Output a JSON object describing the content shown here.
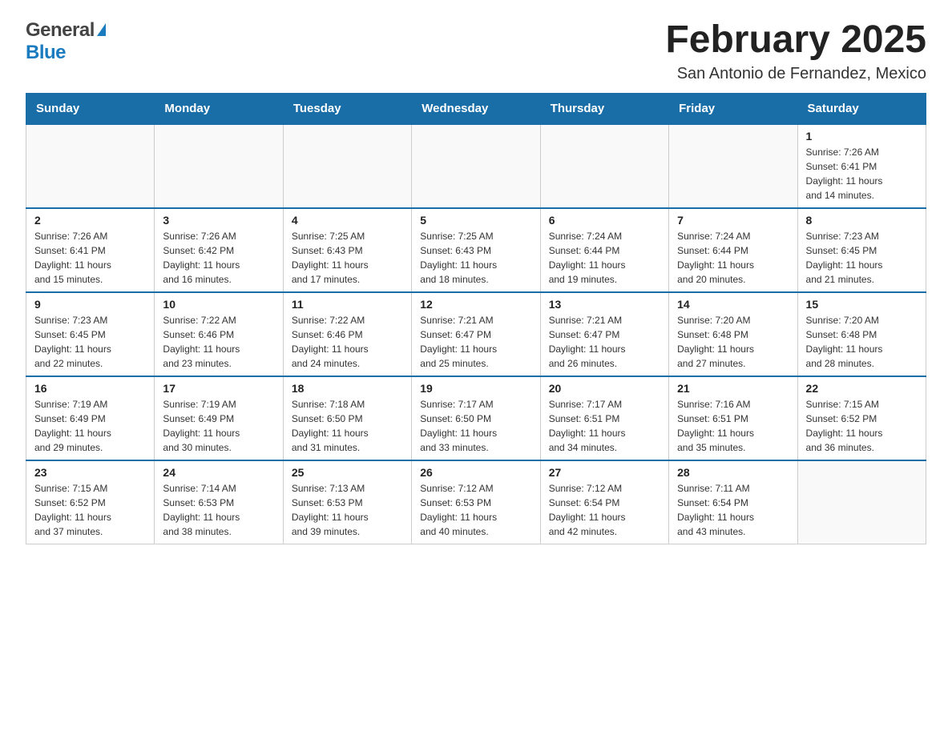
{
  "header": {
    "logo_general": "General",
    "logo_blue": "Blue",
    "title": "February 2025",
    "subtitle": "San Antonio de Fernandez, Mexico"
  },
  "days_of_week": [
    "Sunday",
    "Monday",
    "Tuesday",
    "Wednesday",
    "Thursday",
    "Friday",
    "Saturday"
  ],
  "weeks": [
    [
      {
        "day": "",
        "info": ""
      },
      {
        "day": "",
        "info": ""
      },
      {
        "day": "",
        "info": ""
      },
      {
        "day": "",
        "info": ""
      },
      {
        "day": "",
        "info": ""
      },
      {
        "day": "",
        "info": ""
      },
      {
        "day": "1",
        "info": "Sunrise: 7:26 AM\nSunset: 6:41 PM\nDaylight: 11 hours\nand 14 minutes."
      }
    ],
    [
      {
        "day": "2",
        "info": "Sunrise: 7:26 AM\nSunset: 6:41 PM\nDaylight: 11 hours\nand 15 minutes."
      },
      {
        "day": "3",
        "info": "Sunrise: 7:26 AM\nSunset: 6:42 PM\nDaylight: 11 hours\nand 16 minutes."
      },
      {
        "day": "4",
        "info": "Sunrise: 7:25 AM\nSunset: 6:43 PM\nDaylight: 11 hours\nand 17 minutes."
      },
      {
        "day": "5",
        "info": "Sunrise: 7:25 AM\nSunset: 6:43 PM\nDaylight: 11 hours\nand 18 minutes."
      },
      {
        "day": "6",
        "info": "Sunrise: 7:24 AM\nSunset: 6:44 PM\nDaylight: 11 hours\nand 19 minutes."
      },
      {
        "day": "7",
        "info": "Sunrise: 7:24 AM\nSunset: 6:44 PM\nDaylight: 11 hours\nand 20 minutes."
      },
      {
        "day": "8",
        "info": "Sunrise: 7:23 AM\nSunset: 6:45 PM\nDaylight: 11 hours\nand 21 minutes."
      }
    ],
    [
      {
        "day": "9",
        "info": "Sunrise: 7:23 AM\nSunset: 6:45 PM\nDaylight: 11 hours\nand 22 minutes."
      },
      {
        "day": "10",
        "info": "Sunrise: 7:22 AM\nSunset: 6:46 PM\nDaylight: 11 hours\nand 23 minutes."
      },
      {
        "day": "11",
        "info": "Sunrise: 7:22 AM\nSunset: 6:46 PM\nDaylight: 11 hours\nand 24 minutes."
      },
      {
        "day": "12",
        "info": "Sunrise: 7:21 AM\nSunset: 6:47 PM\nDaylight: 11 hours\nand 25 minutes."
      },
      {
        "day": "13",
        "info": "Sunrise: 7:21 AM\nSunset: 6:47 PM\nDaylight: 11 hours\nand 26 minutes."
      },
      {
        "day": "14",
        "info": "Sunrise: 7:20 AM\nSunset: 6:48 PM\nDaylight: 11 hours\nand 27 minutes."
      },
      {
        "day": "15",
        "info": "Sunrise: 7:20 AM\nSunset: 6:48 PM\nDaylight: 11 hours\nand 28 minutes."
      }
    ],
    [
      {
        "day": "16",
        "info": "Sunrise: 7:19 AM\nSunset: 6:49 PM\nDaylight: 11 hours\nand 29 minutes."
      },
      {
        "day": "17",
        "info": "Sunrise: 7:19 AM\nSunset: 6:49 PM\nDaylight: 11 hours\nand 30 minutes."
      },
      {
        "day": "18",
        "info": "Sunrise: 7:18 AM\nSunset: 6:50 PM\nDaylight: 11 hours\nand 31 minutes."
      },
      {
        "day": "19",
        "info": "Sunrise: 7:17 AM\nSunset: 6:50 PM\nDaylight: 11 hours\nand 33 minutes."
      },
      {
        "day": "20",
        "info": "Sunrise: 7:17 AM\nSunset: 6:51 PM\nDaylight: 11 hours\nand 34 minutes."
      },
      {
        "day": "21",
        "info": "Sunrise: 7:16 AM\nSunset: 6:51 PM\nDaylight: 11 hours\nand 35 minutes."
      },
      {
        "day": "22",
        "info": "Sunrise: 7:15 AM\nSunset: 6:52 PM\nDaylight: 11 hours\nand 36 minutes."
      }
    ],
    [
      {
        "day": "23",
        "info": "Sunrise: 7:15 AM\nSunset: 6:52 PM\nDaylight: 11 hours\nand 37 minutes."
      },
      {
        "day": "24",
        "info": "Sunrise: 7:14 AM\nSunset: 6:53 PM\nDaylight: 11 hours\nand 38 minutes."
      },
      {
        "day": "25",
        "info": "Sunrise: 7:13 AM\nSunset: 6:53 PM\nDaylight: 11 hours\nand 39 minutes."
      },
      {
        "day": "26",
        "info": "Sunrise: 7:12 AM\nSunset: 6:53 PM\nDaylight: 11 hours\nand 40 minutes."
      },
      {
        "day": "27",
        "info": "Sunrise: 7:12 AM\nSunset: 6:54 PM\nDaylight: 11 hours\nand 42 minutes."
      },
      {
        "day": "28",
        "info": "Sunrise: 7:11 AM\nSunset: 6:54 PM\nDaylight: 11 hours\nand 43 minutes."
      },
      {
        "day": "",
        "info": ""
      }
    ]
  ],
  "accent_color": "#1a6ea8"
}
